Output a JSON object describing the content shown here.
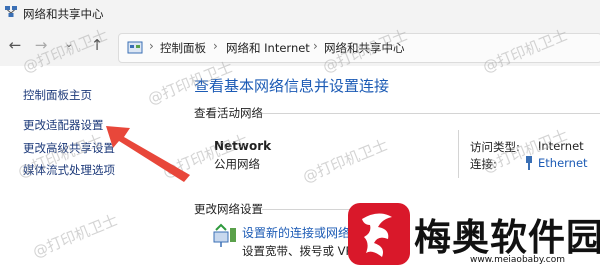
{
  "window": {
    "title": "网络和共享中心"
  },
  "nav": {
    "back_icon": "arrow-left-icon",
    "forward_icon": "arrow-right-icon",
    "history_icon": "chevron-down-icon",
    "up_icon": "arrow-up-icon"
  },
  "breadcrumb": [
    "控制面板",
    "网络和 Internet",
    "网络和共享中心"
  ],
  "sidebar": {
    "items": [
      {
        "label": "控制面板主页"
      },
      {
        "label": "更改适配器设置"
      },
      {
        "label": "更改高级共享设置"
      },
      {
        "label": "媒体流式处理选项"
      }
    ]
  },
  "main": {
    "title": "查看基本网络信息并设置连接",
    "active_networks_label": "查看活动网络",
    "network": {
      "name": "Network",
      "type": "公用网络",
      "access_type_label": "访问类型:",
      "access_type_value": "Internet",
      "connection_label": "连接:",
      "connection_value": "Ethernet"
    },
    "change_settings_label": "更改网络设置",
    "setup": {
      "link": "设置新的连接或网络",
      "desc": "设置宽带、拨号或 VPN"
    }
  },
  "watermark": {
    "text": "@打印机卫士"
  },
  "brand": {
    "name": "梅奥软件园",
    "url": "www.meiaobaby.com"
  },
  "colors": {
    "link": "#1c5bb5",
    "sidebar_link": "#1d3a7a",
    "arrow": "#e8473a",
    "background": "#ffffff",
    "bar": "#f3f3f3"
  }
}
